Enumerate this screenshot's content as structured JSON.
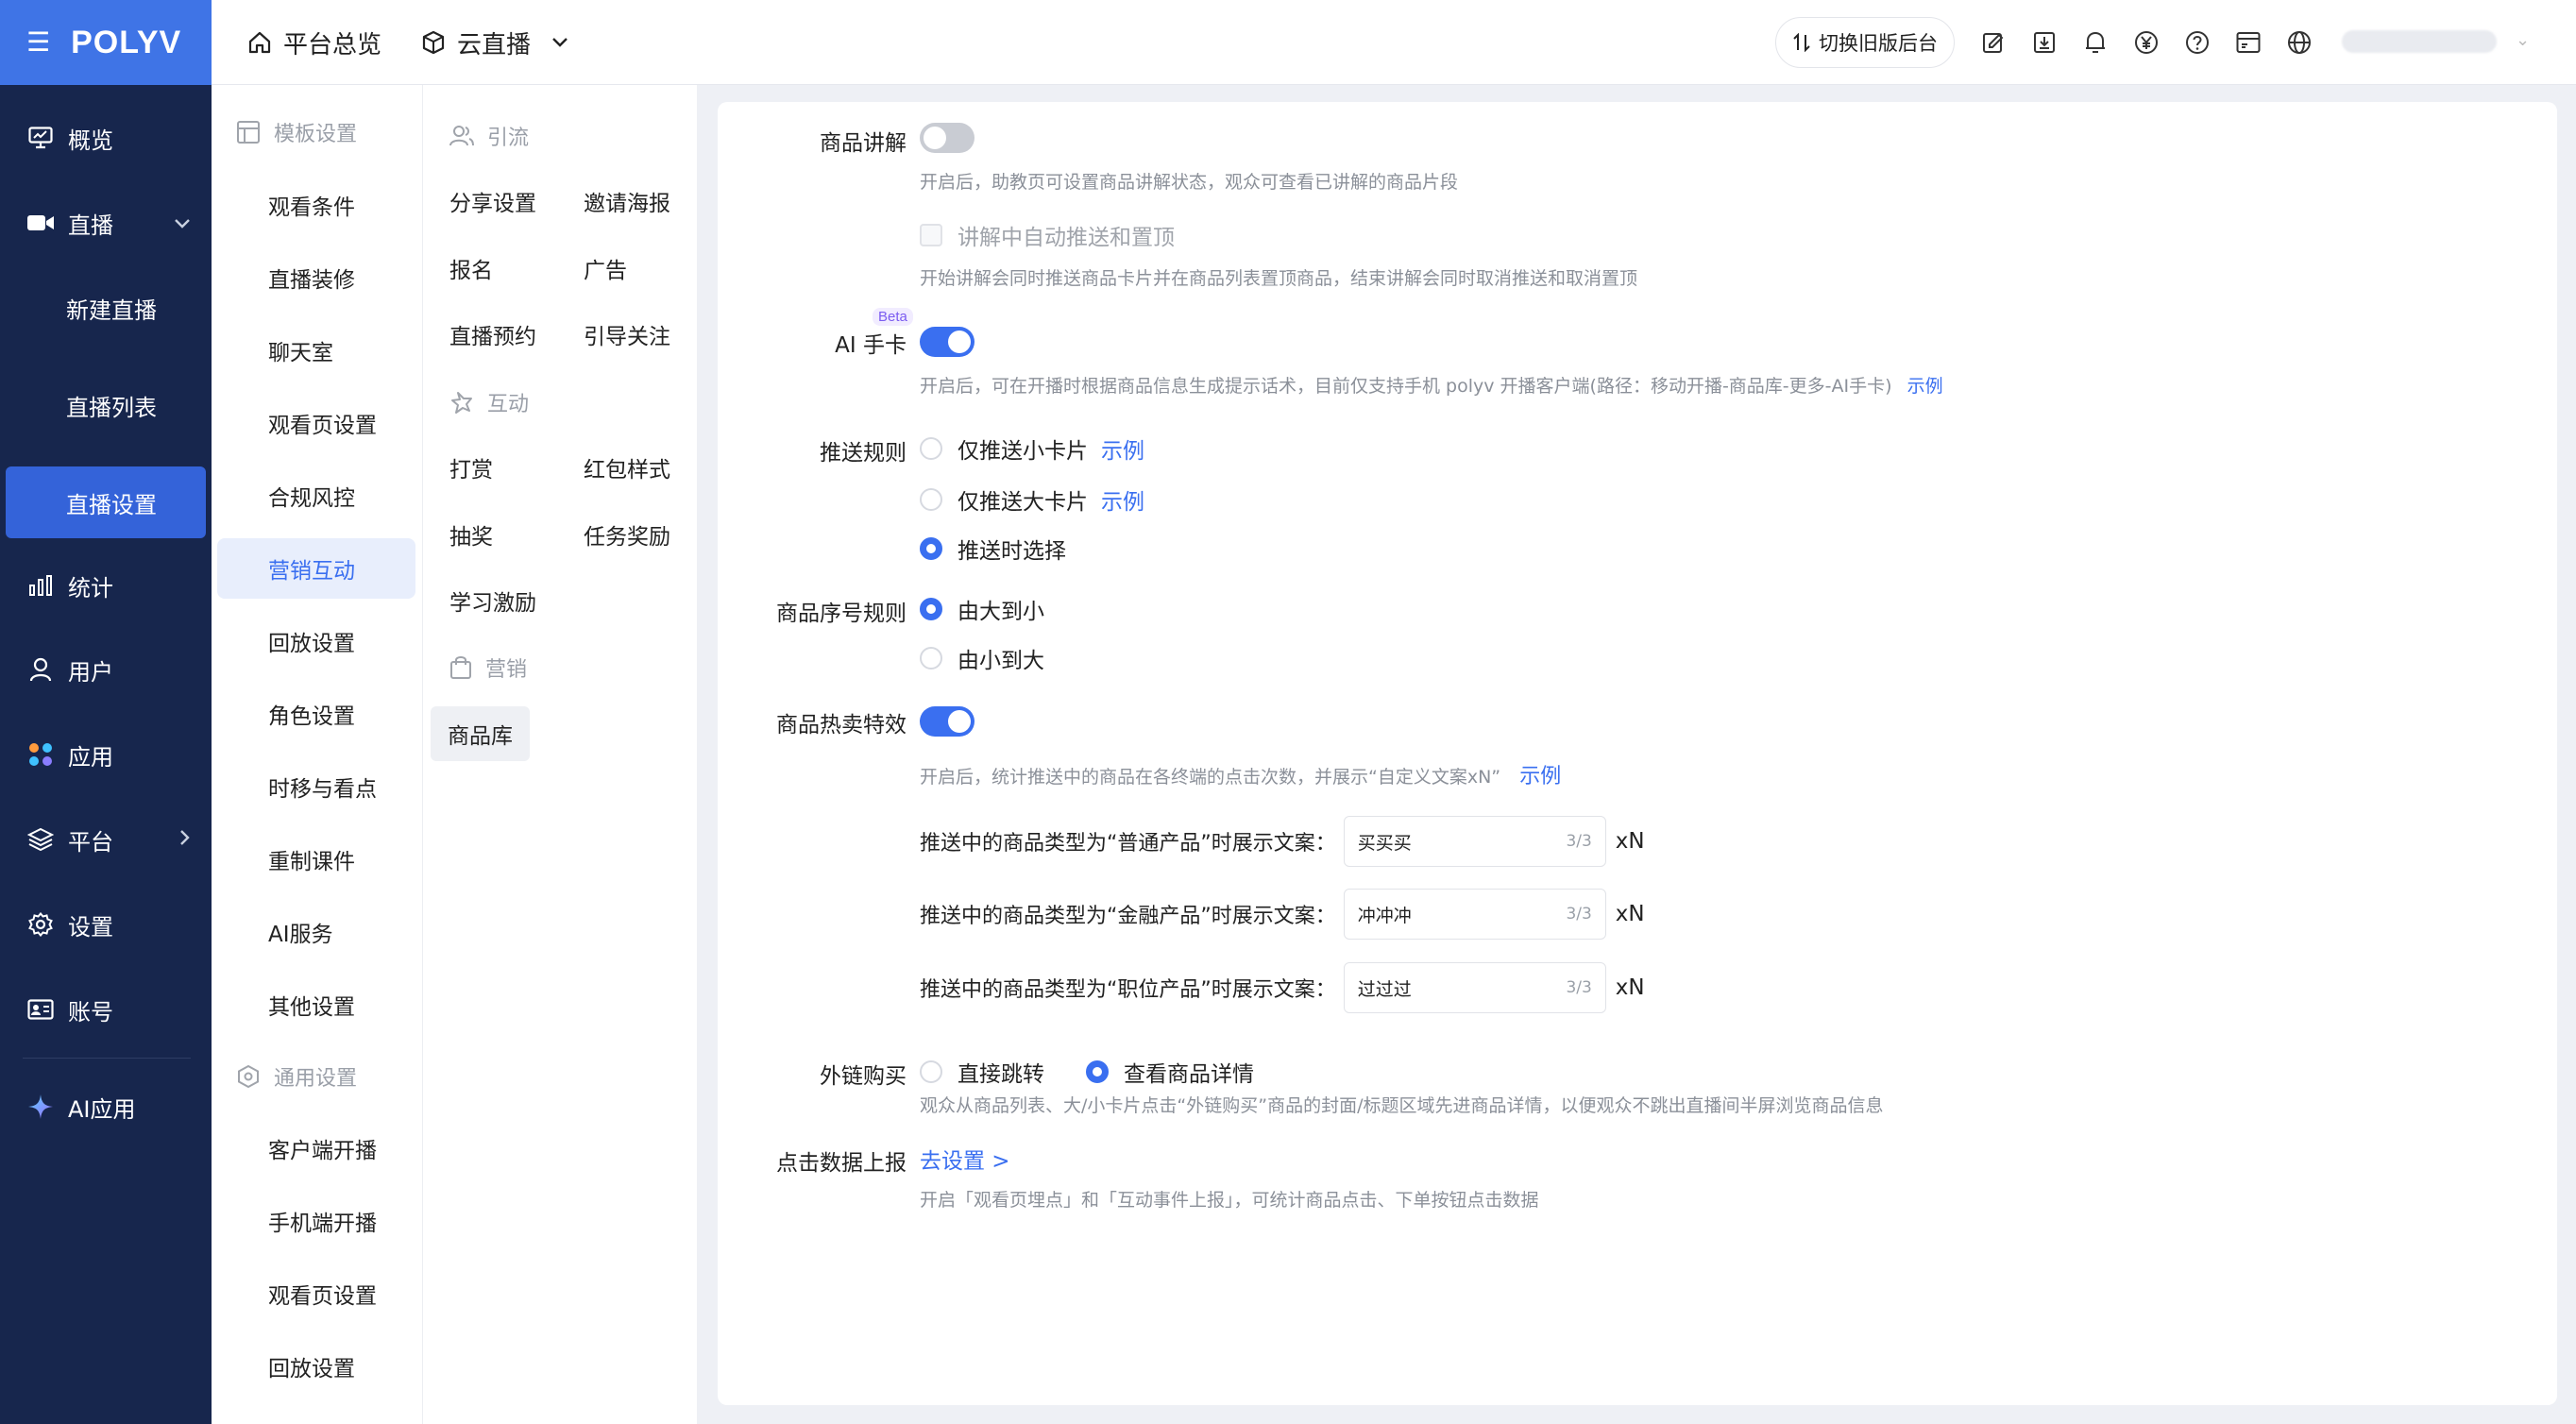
{
  "brand": {
    "logo": "POLYV",
    "accent": "#3a6ff0",
    "nav_bg": "#17264d"
  },
  "header": {
    "crumbs": [
      "平台总览",
      "云直播"
    ],
    "switch_label": "切换旧版后台",
    "icons": [
      "edit-icon",
      "download-icon",
      "bell-icon",
      "yuan-icon",
      "help-icon",
      "card-icon",
      "globe-icon"
    ]
  },
  "nav": {
    "items": [
      {
        "label": "概览"
      },
      {
        "label": "直播"
      },
      {
        "label": "新建直播"
      },
      {
        "label": "直播列表"
      },
      {
        "label": "直播设置"
      },
      {
        "label": "统计"
      },
      {
        "label": "用户"
      },
      {
        "label": "应用"
      },
      {
        "label": "平台"
      },
      {
        "label": "设置"
      },
      {
        "label": "账号"
      },
      {
        "label": "AI应用"
      }
    ]
  },
  "module_menu": {
    "group1": "模板设置",
    "items1": [
      "观看条件",
      "直播装修",
      "聊天室",
      "观看页设置",
      "合规风控",
      "营销互动",
      "回放设置",
      "角色设置",
      "时移与看点",
      "重制课件",
      "AI服务",
      "其他设置"
    ],
    "group2": "通用设置",
    "items2": [
      "客户端开播",
      "手机端开播",
      "观看页设置",
      "回放设置"
    ]
  },
  "sub_menu": {
    "group_traffic": "引流",
    "traffic": [
      "分享设置",
      "邀请海报",
      "报名",
      "广告",
      "直播预约",
      "引导关注"
    ],
    "group_interact": "互动",
    "interact": [
      "打赏",
      "红包样式",
      "抽奖",
      "任务奖励",
      "学习激励"
    ],
    "group_marketing": "营销",
    "marketing": [
      "商品库"
    ]
  },
  "settings": {
    "explain": {
      "label": "商品讲解",
      "enabled": false,
      "desc": "开启后，助教页可设置商品讲解状态，观众可查看已讲解的商品片段",
      "checkbox_label": "讲解中自动推送和置顶",
      "checkbox_desc": "开始讲解会同时推送商品卡片并在商品列表置顶商品，结束讲解会同时取消推送和取消置顶"
    },
    "ai_card": {
      "label": "AI 手卡",
      "beta": "Beta",
      "enabled": true,
      "desc": "开启后，可在开播时根据商品信息生成提示话术，目前仅支持手机 polyv 开播客户端(路径：移动开播-商品库-更多-AI手卡)",
      "example": "示例"
    },
    "push_rule": {
      "label": "推送规则",
      "options": [
        "仅推送小卡片",
        "仅推送大卡片",
        "推送时选择"
      ],
      "example": "示例",
      "selected": "推送时选择"
    },
    "order_rule": {
      "label": "商品序号规则",
      "options": [
        "由大到小",
        "由小到大"
      ],
      "selected": "由大到小"
    },
    "hot_effect": {
      "label": "商品热卖特效",
      "enabled": true,
      "desc": "开启后，统计推送中的商品在各终端的点击次数，并展示“自定义文案xN”",
      "example": "示例",
      "rows": [
        {
          "label": "推送中的商品类型为“普通产品”时展示文案：",
          "value": "买买买",
          "count": "3/3",
          "suffix": "xN"
        },
        {
          "label": "推送中的商品类型为“金融产品”时展示文案：",
          "value": "冲冲冲",
          "count": "3/3",
          "suffix": "xN"
        },
        {
          "label": "推送中的商品类型为“职位产品”时展示文案：",
          "value": "过过过",
          "count": "3/3",
          "suffix": "xN"
        }
      ]
    },
    "external_buy": {
      "label": "外链购买",
      "options": [
        "直接跳转",
        "查看商品详情"
      ],
      "selected": "查看商品详情",
      "desc": "观众从商品列表、大/小卡片点击“外链购买”商品的封面/标题区域先进商品详情，以便观众不跳出直播间半屏浏览商品信息"
    },
    "click_report": {
      "label": "点击数据上报",
      "link": "去设置 >",
      "desc": "开启「观看页埋点」和「互动事件上报」，可统计商品点击、下单按钮点击数据"
    }
  }
}
